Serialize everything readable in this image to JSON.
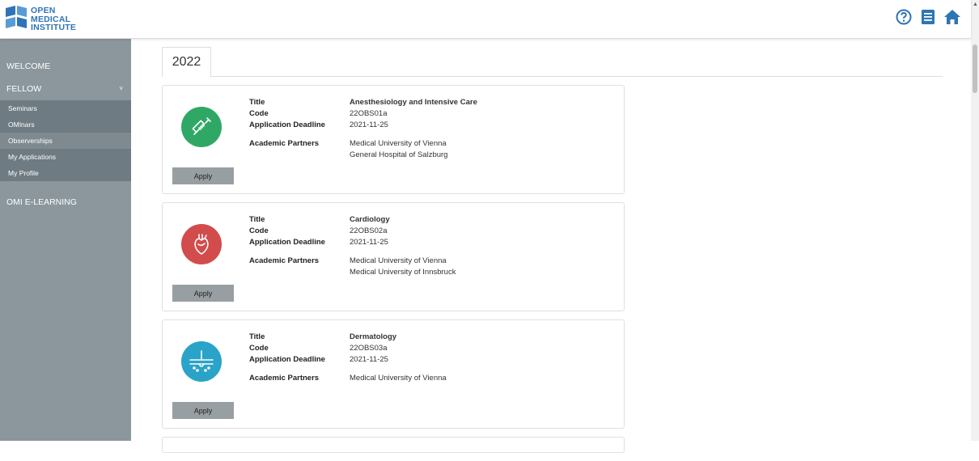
{
  "brand": {
    "line1": "OPEN",
    "line2": "MEDICAL",
    "line3": "INSTITUTE",
    "color": "#2f74b5"
  },
  "top_icons": [
    "help-circle-icon",
    "book-icon",
    "home-icon"
  ],
  "sidebar": {
    "welcome": "WELCOME",
    "fellow": "FELLOW",
    "fellow_chevron": "˅",
    "sub_items": [
      {
        "label": "Seminars"
      },
      {
        "label": "OMInars"
      },
      {
        "label": "Observerships"
      },
      {
        "label": "My Applications"
      },
      {
        "label": "My Profile"
      }
    ],
    "elearning": "OMI E-LEARNING"
  },
  "tab": "2022",
  "labels": {
    "title": "Title",
    "code": "Code",
    "deadline": "Application Deadline",
    "partners": "Academic Partners",
    "apply": "Apply"
  },
  "programs": [
    {
      "title": "Anesthesiology and Intensive Care",
      "code": "22OBS01a",
      "deadline": "2021-11-25",
      "partners": [
        "Medical University of Vienna",
        "General Hospital of Salzburg"
      ],
      "icon": "syringe-icon",
      "color": "#2fa866"
    },
    {
      "title": "Cardiology",
      "code": "22OBS02a",
      "deadline": "2021-11-25",
      "partners": [
        "Medical University of Vienna",
        "Medical University of Innsbruck"
      ],
      "icon": "heart-icon",
      "color": "#d24c4c"
    },
    {
      "title": "Dermatology",
      "code": "22OBS03a",
      "deadline": "2021-11-25",
      "partners": [
        "Medical University of Vienna"
      ],
      "icon": "skin-hair-icon",
      "color": "#2aa3c8"
    }
  ]
}
